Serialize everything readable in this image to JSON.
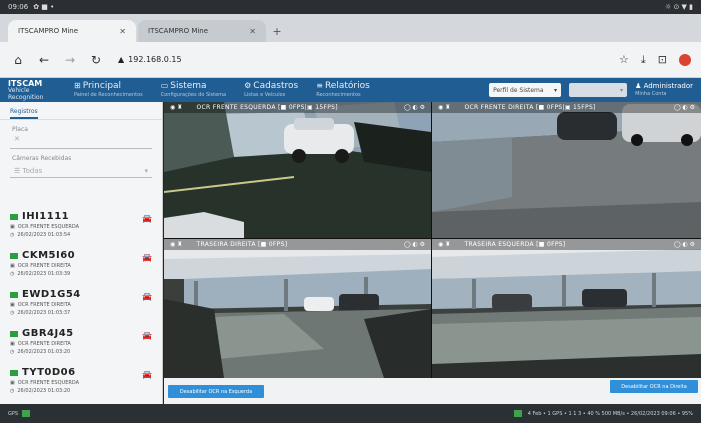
{
  "os": {
    "time": "09:06",
    "icons": "✿ ■ •",
    "right_icons": "☼ ⊙ ▼ ▮"
  },
  "tabs": [
    {
      "label": "ITSCAMPRO Mine"
    },
    {
      "label": "ITSCAMPRO Mine"
    }
  ],
  "browser": {
    "url": "192.168.0.15",
    "security": "▲"
  },
  "header": {
    "logo_main": "ITSCAM",
    "logo_sub": "Vehicle Recognition",
    "menu": [
      {
        "label": "Principal",
        "sub": "Painel de Reconhecimentos",
        "icon": "⊞"
      },
      {
        "label": "Sistema",
        "sub": "Configurações do Sistema",
        "icon": "▭"
      },
      {
        "label": "Cadastros",
        "sub": "Listas e Veículos",
        "icon": "⚙"
      },
      {
        "label": "Relatórios",
        "sub": "Reconhecimentos",
        "icon": "≡"
      }
    ],
    "profile_select": "Perfil de Sistema",
    "dim_select": "",
    "admin": "Administrador",
    "admin_sub": "Minha Conta"
  },
  "sidebar": {
    "tab": "Registros",
    "filter_label": "Placa",
    "filter_placeholder": "",
    "camera_label": "Câmeras Recebidas",
    "camera_value": "Todas",
    "plates": [
      {
        "plate": "IHI1111",
        "camera": "OCR FRENTE ESQUERDA",
        "datetime": "26/02/2023 01:03:54"
      },
      {
        "plate": "CKM5I60",
        "camera": "OCR FRENTE DIREITA",
        "datetime": "26/02/2023 01:03:39"
      },
      {
        "plate": "EWD1G54",
        "camera": "OCR FRENTE DIREITA",
        "datetime": "26/02/2023 01:03:37"
      },
      {
        "plate": "GBR4J45",
        "camera": "OCR FRENTE DIREITA",
        "datetime": "26/02/2023 01:03:20"
      },
      {
        "plate": "TYT0D06",
        "camera": "OCR FRENTE ESQUERDA",
        "datetime": "26/02/2023 01:03:20"
      }
    ]
  },
  "cameras": [
    {
      "title": "OCR FRENTE ESQUERDA",
      "fps": "[■ 0FPS|▣ 15FPS]"
    },
    {
      "title": "OCR FRENTE DIREITA",
      "fps": "[■ 0FPS|▣ 15FPS]"
    },
    {
      "title": "TRASEIRA DIREITA",
      "fps": "[■ 0FPS]"
    },
    {
      "title": "TRASEIRA ESQUERDA",
      "fps": "[■ 0FPS]"
    }
  ],
  "buttons": {
    "left": "Desabilitar OCR na Esquerda",
    "right": "Desabilitar OCR na Direita"
  },
  "status": {
    "left": "GPS",
    "right": "4 Feb • 1 GPS • 1 1 3 • 40 % 500 MB/s • 26/02/2023 09:06 • 95%"
  }
}
